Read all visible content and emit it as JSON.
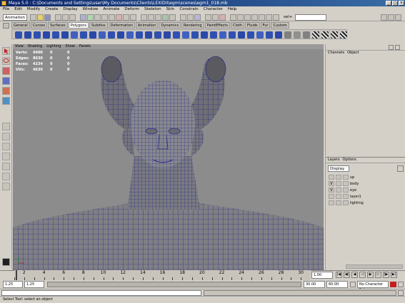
{
  "window": {
    "title": "Maya 5.0 : C:\\Documents and Settings\\user\\My Documents\\Clients\\LEXIDII\\egm\\scenes\\egm1_018.mb",
    "minimize": "_",
    "maximize": "□",
    "close": "×"
  },
  "menubar": [
    "File",
    "Edit",
    "Modify",
    "Create",
    "Display",
    "Window",
    "Animate",
    "Deform",
    "Skeleton",
    "Skin",
    "Constrain",
    "Character",
    "Help"
  ],
  "statusline": {
    "mode_dropdown": "Animation",
    "sel_label": "sel+"
  },
  "shelf": {
    "tabs": [
      "General",
      "Curves",
      "Surfaces",
      "Polygons",
      "Subdivs",
      "Deformation",
      "Animation",
      "Dynamics",
      "Rendering",
      "PaintEffects",
      "Cloth",
      "Fluids",
      "Fur",
      "Custom"
    ],
    "active_tab": "Polygons"
  },
  "viewport": {
    "menu": [
      "View",
      "Shading",
      "Lighting",
      "Show",
      "Panels"
    ],
    "hud": [
      {
        "label": "Verts:",
        "v1": "4400",
        "v2": "0",
        "v3": "0"
      },
      {
        "label": "Edges:",
        "v1": "8630",
        "v2": "0",
        "v3": "0"
      },
      {
        "label": "Faces:",
        "v1": "4234",
        "v2": "0",
        "v3": "0"
      },
      {
        "label": "UVs:",
        "v1": "4630",
        "v2": "0",
        "v3": "0"
      }
    ],
    "wire_color": "#1b1f8a",
    "surface_color": "#7f7f84",
    "background_color": "#8c8c8c"
  },
  "channelbox": {
    "menu": [
      "Channels",
      "Object"
    ]
  },
  "layers": {
    "menu": [
      "Layers",
      "Options"
    ],
    "dropdown": "Display",
    "rows": [
      {
        "v": "",
        "p": "",
        "name": "up"
      },
      {
        "v": "V",
        "p": "",
        "name": "body"
      },
      {
        "v": "V",
        "p": "",
        "name": "eye"
      },
      {
        "v": "",
        "p": "",
        "name": "layer1"
      },
      {
        "v": "",
        "p": "",
        "name": "lighting"
      }
    ]
  },
  "timeline": {
    "tick_labels": [
      "2",
      "4",
      "6",
      "8",
      "10",
      "12",
      "14",
      "16",
      "18",
      "20",
      "22",
      "24",
      "26",
      "28",
      "30"
    ],
    "current_frame": "1.00"
  },
  "range": {
    "start": "1.25",
    "inner_start": "1.25",
    "inner_end": "30.00",
    "end": "60.00",
    "character_set": "No Character Set"
  },
  "help": {
    "text": "Select Tool: select an object"
  }
}
